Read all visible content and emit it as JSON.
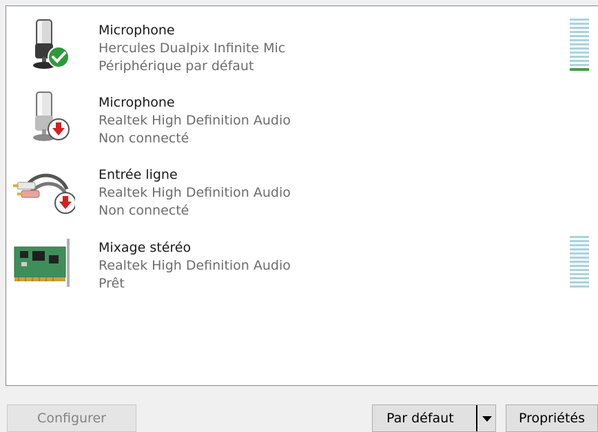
{
  "devices": [
    {
      "name": "Microphone",
      "description": "Hercules Dualpix Infinite Mic",
      "status": "Périphérique par défaut",
      "icon": "microphone-default-icon",
      "status_badge": "check-badge-icon",
      "level": 0.08
    },
    {
      "name": "Microphone",
      "description": "Realtek High Definition Audio",
      "status": "Non connecté",
      "icon": "microphone-icon",
      "status_badge": "disconnected-arrow-icon"
    },
    {
      "name": "Entrée ligne",
      "description": "Realtek High Definition Audio",
      "status": "Non connecté",
      "icon": "line-in-cable-icon",
      "status_badge": "disconnected-arrow-icon"
    },
    {
      "name": "Mixage stéréo",
      "description": "Realtek High Definition Audio",
      "status": "Prêt",
      "icon": "sound-card-icon",
      "level": 0
    }
  ],
  "buttons": {
    "configure": "Configurer",
    "set_default": "Par défaut",
    "properties": "Propriétés"
  },
  "colors": {
    "meter_idle": "#a8d3e0",
    "meter_active": "#3fa045",
    "check_green": "#2e9a3a",
    "disconnect_red": "#d42020"
  }
}
